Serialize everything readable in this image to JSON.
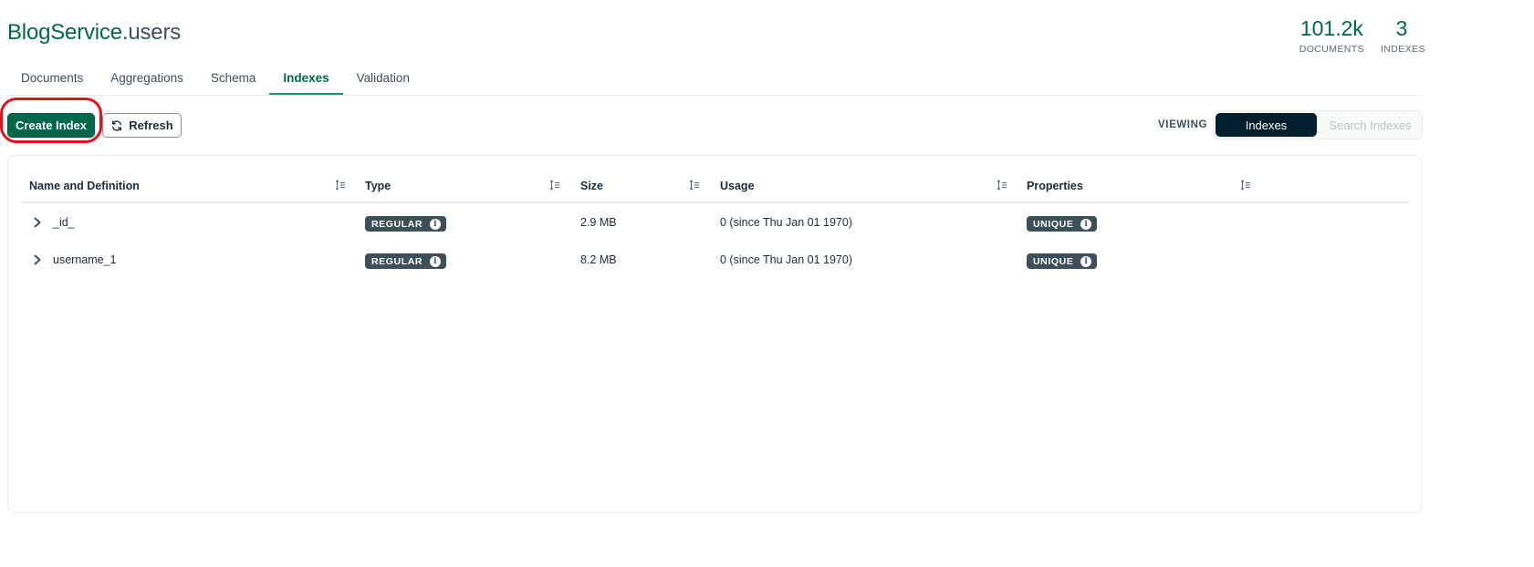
{
  "header": {
    "db_name": "BlogService",
    "coll_name": ".users",
    "stats": {
      "documents_value": "101.2k",
      "documents_label": "DOCUMENTS",
      "indexes_value": "3",
      "indexes_label": "INDEXES"
    }
  },
  "tabs": [
    {
      "label": "Documents"
    },
    {
      "label": "Aggregations"
    },
    {
      "label": "Schema"
    },
    {
      "label": "Indexes",
      "active": true
    },
    {
      "label": "Validation"
    }
  ],
  "toolbar": {
    "create_label": "Create Index",
    "refresh_label": "Refresh",
    "viewing_label": "VIEWING",
    "view_options": [
      "Indexes",
      "Search Indexes"
    ],
    "selected_view": "Indexes"
  },
  "table": {
    "columns": [
      "Name and Definition",
      "Type",
      "Size",
      "Usage",
      "Properties"
    ],
    "rows": [
      {
        "name": "_id_",
        "type": "REGULAR",
        "size": "2.9 MB",
        "usage": "0 (since Thu Jan 01 1970)",
        "properties": "UNIQUE"
      },
      {
        "name": "username_1",
        "type": "REGULAR",
        "size": "8.2 MB",
        "usage": "0 (since Thu Jan 01 1970)",
        "properties": "UNIQUE"
      }
    ]
  },
  "colors": {
    "brand_green": "#00684a",
    "tab_underline": "#00a35c",
    "badge_bg": "#3d4f58",
    "segment_on": "#001e2b",
    "highlight_ring": "#e1141e"
  },
  "icons": [
    "refresh-icon",
    "sort-icon",
    "chevron-right-icon",
    "info-icon"
  ]
}
